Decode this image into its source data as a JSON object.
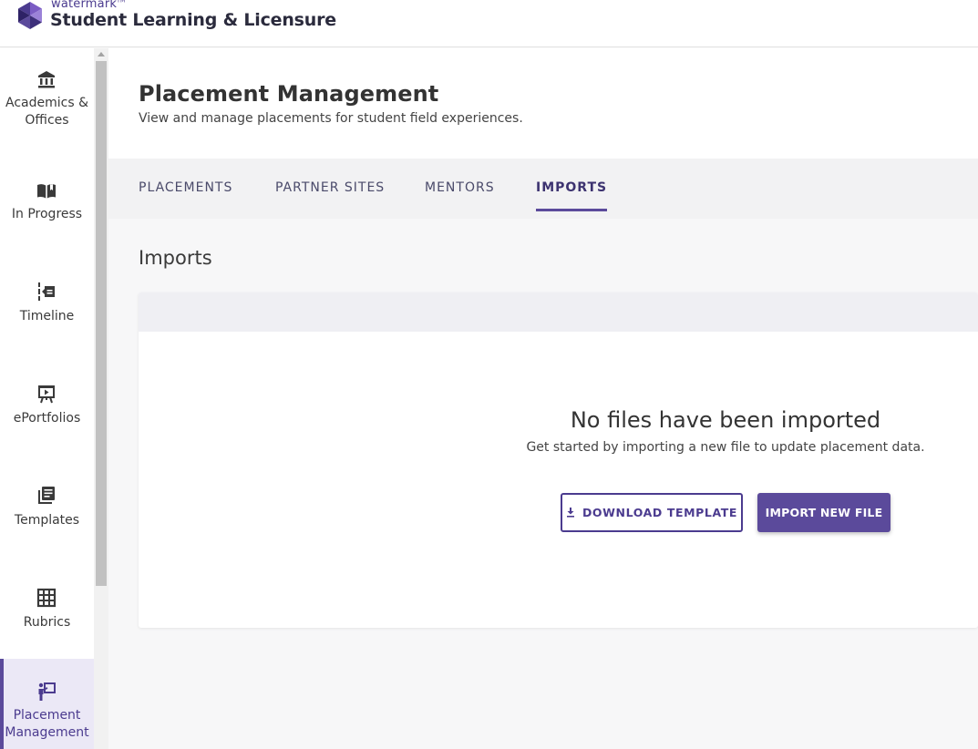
{
  "header": {
    "brand_small": "watermark",
    "brand_tm": "TM",
    "app_title": "Student Learning & Licensure"
  },
  "sidebar": {
    "items": [
      {
        "label": "Academics & Offices",
        "icon": "institution-icon",
        "active": false
      },
      {
        "label": "In Progress",
        "icon": "open-book-icon",
        "active": false
      },
      {
        "label": "Timeline",
        "icon": "timeline-icon",
        "active": false
      },
      {
        "label": "ePortfolios",
        "icon": "presentation-board-icon",
        "active": false
      },
      {
        "label": "Templates",
        "icon": "library-books-icon",
        "active": false
      },
      {
        "label": "Rubrics",
        "icon": "grid-table-icon",
        "active": false
      },
      {
        "label": "Placement Management",
        "icon": "teacher-board-icon",
        "active": true
      }
    ]
  },
  "page": {
    "title": "Placement Management",
    "subtitle": "View and manage placements for student field experiences."
  },
  "tabs": [
    {
      "label": "PLACEMENTS",
      "active": false
    },
    {
      "label": "PARTNER SITES",
      "active": false
    },
    {
      "label": "MENTORS",
      "active": false
    },
    {
      "label": "IMPORTS",
      "active": true
    }
  ],
  "imports": {
    "section_title": "Imports",
    "empty_title": "No files have been imported",
    "empty_subtitle": "Get started by importing a new file to update placement data.",
    "download_button": "DOWNLOAD TEMPLATE",
    "import_button": "IMPORT NEW FILE"
  },
  "colors": {
    "accent": "#5b4a9b",
    "accent_dark": "#4b3b8f",
    "active_nav_bg": "#ebe8f6"
  }
}
